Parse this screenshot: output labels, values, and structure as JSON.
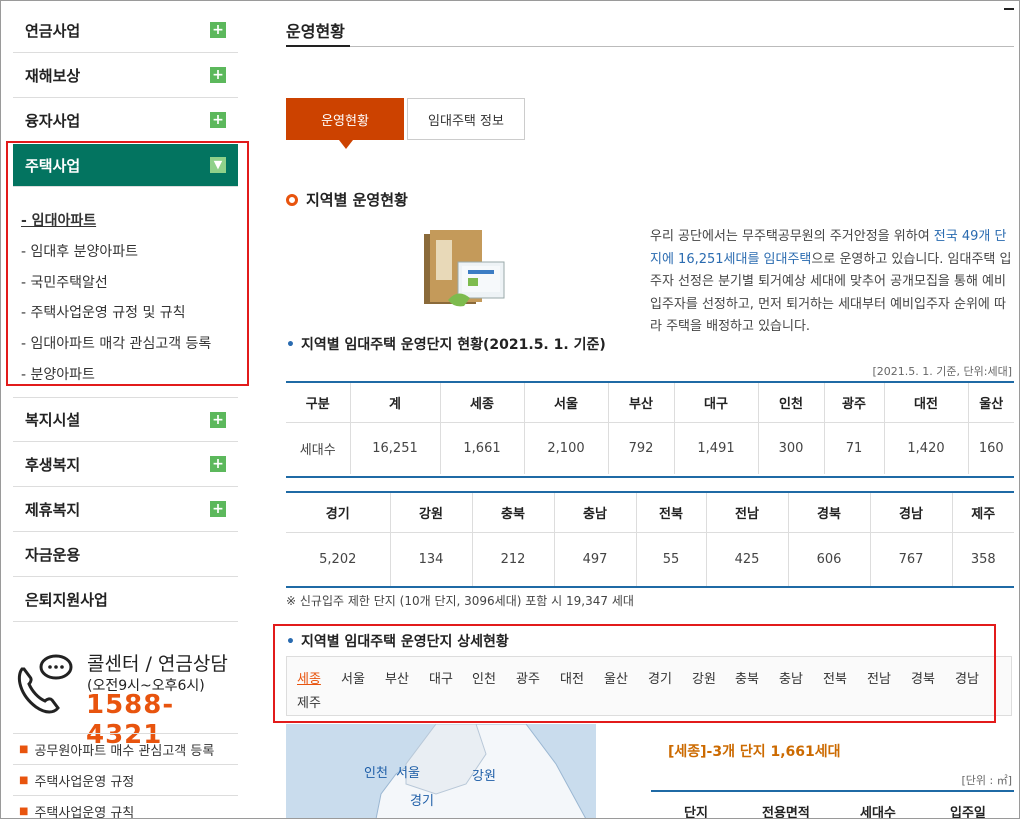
{
  "sidebar": {
    "items_top": [
      "연금사업",
      "재해보상",
      "융자사업"
    ],
    "active": "주택사업",
    "submenu": [
      "- 임대아파트",
      "- 임대후 분양아파트",
      "- 국민주택알선",
      "- 주택사업운영 규정 및 규칙",
      "- 임대아파트 매각 관심고객 등록",
      "- 분양아파트"
    ],
    "items_bottom": [
      "복지시설",
      "후생복지",
      "제휴복지",
      "자금운용",
      "은퇴지원사업"
    ],
    "callcenter": {
      "title": "콜센터 / 연금상담",
      "hours": "(오전9시~오후6시)",
      "phone": "1588-4321"
    },
    "quick_links": [
      "공무원아파트 매수 관심고객 등록",
      "주택사업운영 규정",
      "주택사업운영 규칙"
    ]
  },
  "main": {
    "page_title": "운영현황",
    "tabs": [
      "운영현황",
      "임대주택 정보"
    ],
    "section_title": "지역별 운영현황",
    "intro": {
      "p1": "우리 공단에서는 무주택공무원의 주거안정을 위하여 ",
      "hl": "전국 49개 단지에 16,251세대를 임대주택",
      "p2": "으로 운영하고 있습니다. 임대주택 입주자 선정은 분기별 퇴거예상 세대에 맞추어 공개모집을 통해 예비입주자를 선정하고, 먼저 퇴거하는 세대부터 예비입주자 순위에 따라 주택을 배정하고 있습니다."
    },
    "table_title": "지역별 임대주택 운영단지 현황(2021.5. 1. 기준)",
    "table_unit": "[2021.5. 1. 기준, 단위:세대]",
    "table1": {
      "headers": [
        "구분",
        "계",
        "세종",
        "서울",
        "부산",
        "대구",
        "인천",
        "광주",
        "대전",
        "울산"
      ],
      "values": [
        "세대수",
        "16,251",
        "1,661",
        "2,100",
        "792",
        "1,491",
        "300",
        "71",
        "1,420",
        "160"
      ]
    },
    "table2": {
      "headers": [
        "경기",
        "강원",
        "충북",
        "충남",
        "전북",
        "전남",
        "경북",
        "경남",
        "제주"
      ],
      "values": [
        "5,202",
        "134",
        "212",
        "497",
        "55",
        "425",
        "606",
        "767",
        "358"
      ]
    },
    "note": "※ 신규입주 제한 단지 (10개 단지, 3096세대) 포함 시 19,347 세대",
    "detail_title": "지역별 임대주택 운영단지 상세현황",
    "regions": [
      "세종",
      "서울",
      "부산",
      "대구",
      "인천",
      "광주",
      "대전",
      "울산",
      "경기",
      "강원",
      "충북",
      "충남",
      "전북",
      "전남",
      "경북",
      "경남",
      "제주"
    ],
    "selected_region": "세종",
    "map_labels": [
      "인천",
      "서울",
      "강원",
      "경기"
    ],
    "sejong_title": "[세종]-3개 단지 1,661세대",
    "unit2": "[단위 : ㎡]",
    "table3_headers": [
      "단지",
      "전용면적",
      "세대수",
      "입주일"
    ]
  },
  "colors": {
    "accent": "#cc4200",
    "green": "#037460",
    "blue": "#1f6aa5",
    "orange": "#e8540e"
  }
}
